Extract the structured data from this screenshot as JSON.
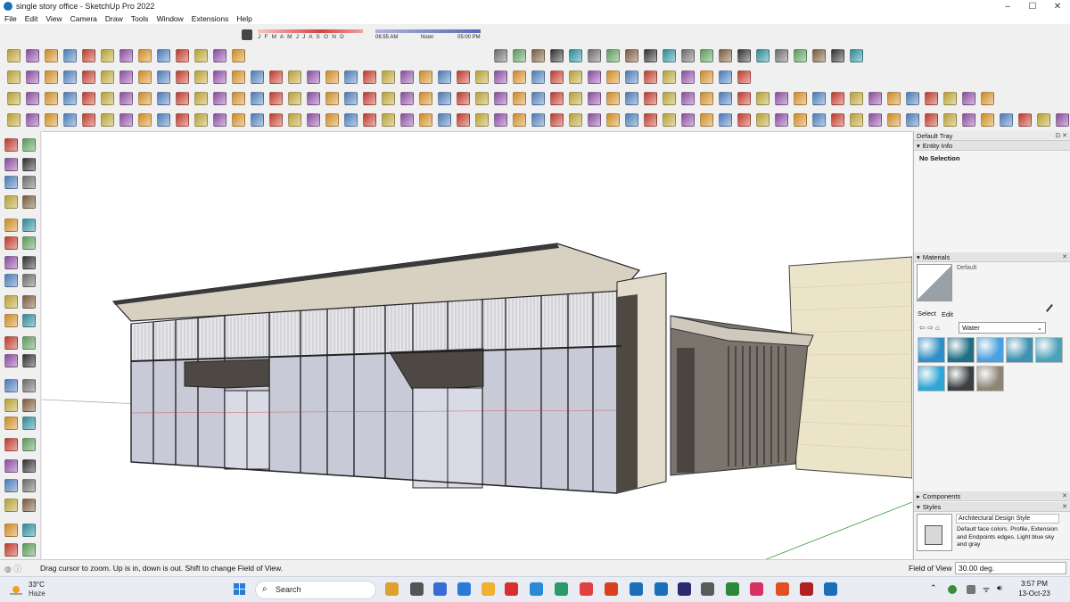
{
  "window": {
    "title": "single story office - SketchUp Pro 2022",
    "controls": [
      "–",
      "☐",
      "✕"
    ]
  },
  "menu": [
    "File",
    "Edit",
    "View",
    "Camera",
    "Draw",
    "Tools",
    "Window",
    "Extensions",
    "Help"
  ],
  "shadows": {
    "months": "J F M A M J J A S O N D",
    "time_start": "06:55 AM",
    "time_mid": "Noon",
    "time_end": "05:00 PM"
  },
  "tray": {
    "title": "Default Tray",
    "entity_info": {
      "label": "Entity Info",
      "value": "No Selection"
    },
    "materials": {
      "label": "Materials",
      "current": "Default",
      "tab_select": "Select",
      "tab_edit": "Edit",
      "library": "Water",
      "swatches": [
        "#2f8fc8",
        "#1f6f86",
        "#4aa0e0",
        "#3d93b0",
        "#4aa3b8",
        "#2ea6d6",
        "#3d4043",
        "#8f8576"
      ]
    },
    "components": {
      "label": "Components"
    },
    "styles": {
      "label": "Styles",
      "name": "Architectural Design Style",
      "description": "Default face colors. Profile, Extension and Endpoints edges. Light blue sky and gray"
    }
  },
  "status": {
    "hint": "Drag cursor to zoom.  Up is in, down is out. Shift to change Field of View.",
    "fov_label": "Field of View",
    "fov_value": "30.00 deg."
  },
  "taskbar": {
    "temp": "33°C",
    "condition": "Haze",
    "search_label": "Search",
    "time": "3:57 PM",
    "date": "13-Oct-23"
  }
}
